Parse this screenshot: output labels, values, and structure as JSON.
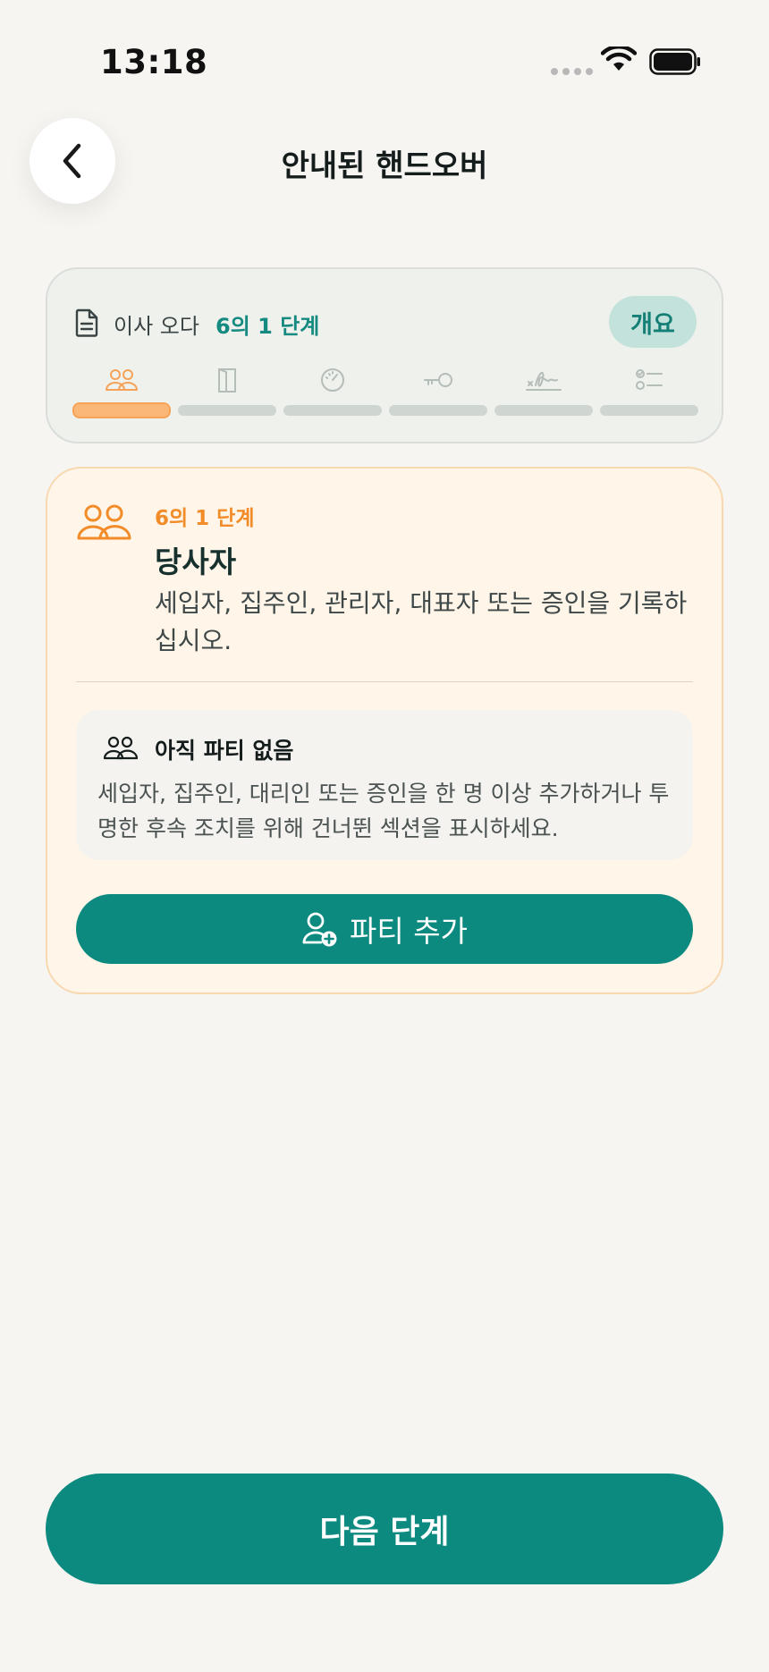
{
  "status_bar": {
    "time": "13:18"
  },
  "header": {
    "title": "안내된 핸드오버"
  },
  "progress": {
    "label": "이사 오다",
    "step_text": "6의 1 단계",
    "overview_label": "개요",
    "current_step": 1,
    "total_steps": 6,
    "steps": [
      {
        "icon": "people-icon",
        "active": true
      },
      {
        "icon": "door-icon",
        "active": false
      },
      {
        "icon": "gauge-icon",
        "active": false
      },
      {
        "icon": "key-icon",
        "active": false
      },
      {
        "icon": "signature-icon",
        "active": false
      },
      {
        "icon": "checklist-icon",
        "active": false
      }
    ]
  },
  "section": {
    "step_label": "6의 1 단계",
    "title": "당사자",
    "description": "세입자, 집주인, 관리자, 대표자 또는 증인을 기록하십시오.",
    "empty_title": "아직 파티 없음",
    "empty_description": "세입자, 집주인, 대리인 또는 증인을 한 명 이상 추가하거나 투명한 후속 조치를 위해 건너뛴 섹션을 표시하세요.",
    "add_button_label": "파티 추가"
  },
  "footer": {
    "next_label": "다음 단계"
  },
  "colors": {
    "accent": "#0d8a80",
    "active_step": "#fbb777",
    "step_orange": "#f28c28",
    "background": "#f6f5f1",
    "card_bg": "#fff5e8"
  }
}
